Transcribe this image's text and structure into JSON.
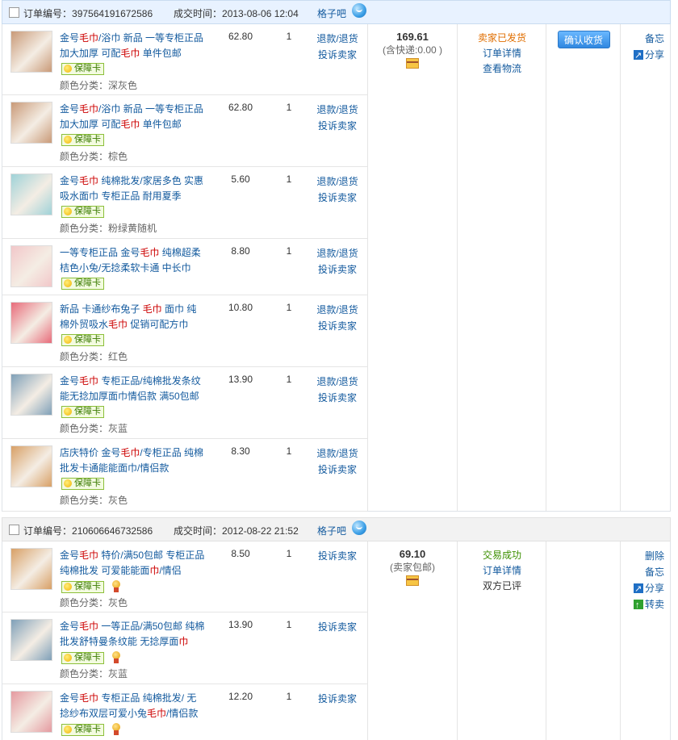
{
  "labels": {
    "order_no": "订单编号：",
    "deal_time": "成交时间：",
    "guarantee": "保障卡",
    "refund": "退款/退货",
    "complain": "投诉卖家",
    "order_detail": "订单详情",
    "view_logistics": "查看物流",
    "confirm_receipt": "确认收货",
    "memo": "备忘",
    "share": "分享",
    "delete": "删除",
    "resell": "转卖"
  },
  "orders": [
    {
      "order_no": "397564191672586",
      "deal_time": "2013-08-06 12:04",
      "shop": "格子吧",
      "total": "169.61",
      "shipping": "(含快递:0.00 )",
      "status": "卖家已发货",
      "items": [
        {
          "title_parts": [
            "金号",
            "毛巾",
            "/浴巾 新品 一等专柜正品加大加厚 可配",
            "毛巾",
            " 单件包邮"
          ],
          "attr": "颜色分类：深灰色",
          "price": "62.80",
          "qty": "1"
        },
        {
          "title_parts": [
            "金号",
            "毛巾",
            "/浴巾 新品 一等专柜正品加大加厚 可配",
            "毛巾",
            " 单件包邮"
          ],
          "attr": "颜色分类：棕色",
          "price": "62.80",
          "qty": "1"
        },
        {
          "title_parts": [
            "金号",
            "毛巾",
            " 纯棉批发/家居多色 实惠吸水面巾 专柜正品 耐用夏季"
          ],
          "attr": "颜色分类：粉绿黄随机",
          "price": "5.60",
          "qty": "1"
        },
        {
          "title_parts": [
            "一等专柜正品 金号",
            "毛巾",
            " 纯棉超柔桔色小兔/无捻柔软卡通 中长巾"
          ],
          "attr": "",
          "price": "8.80",
          "qty": "1"
        },
        {
          "title_parts": [
            "新品 卡通纱布兔子 ",
            "毛巾",
            " 面巾 纯棉外贸吸水",
            "毛巾",
            " 促销可配方巾"
          ],
          "attr": "颜色分类：红色",
          "price": "10.80",
          "qty": "1"
        },
        {
          "title_parts": [
            "金号",
            "毛巾",
            " 专柜正品/纯棉批发条纹能无捻加厚面巾情侣款 满50包邮"
          ],
          "attr": "颜色分类：灰蓝",
          "price": "13.90",
          "qty": "1"
        },
        {
          "title_parts": [
            "店庆特价 金号",
            "毛巾",
            "/专柜正品 纯棉批发卡通能能面巾/情侣款"
          ],
          "attr": "颜色分类：灰色",
          "price": "8.30",
          "qty": "1"
        }
      ]
    },
    {
      "order_no": "210606646732586",
      "deal_time": "2012-08-22 21:52",
      "shop": "格子吧",
      "total": "69.10",
      "shipping": "(卖家包邮)",
      "status": "交易成功",
      "rated": "双方已评",
      "items": [
        {
          "title_parts": [
            "金号",
            "毛巾",
            " 特价/满50包邮 专柜正品 纯棉批发 可爱能能面",
            "巾",
            "/情侣"
          ],
          "attr": "颜色分类：灰色",
          "price": "8.50",
          "qty": "1"
        },
        {
          "title_parts": [
            "金号",
            "毛巾",
            " 一等正品/满50包邮 纯棉批发舒特曼条纹能 无捻厚面",
            "巾"
          ],
          "attr": "颜色分类：灰蓝",
          "price": "13.90",
          "qty": "1"
        },
        {
          "title_parts": [
            "金号",
            "毛巾",
            " 专柜正品 纯棉批发/ 无捻纱布双层可爱小兔",
            "毛巾",
            "/情侣款"
          ],
          "attr": "",
          "price": "12.20",
          "qty": "1"
        }
      ]
    }
  ],
  "colors": {
    "link": "#135a9e",
    "highlight": "#cc0000",
    "shipped": "#e06e00",
    "success": "#3c8f00",
    "button": "#2f87e0"
  }
}
